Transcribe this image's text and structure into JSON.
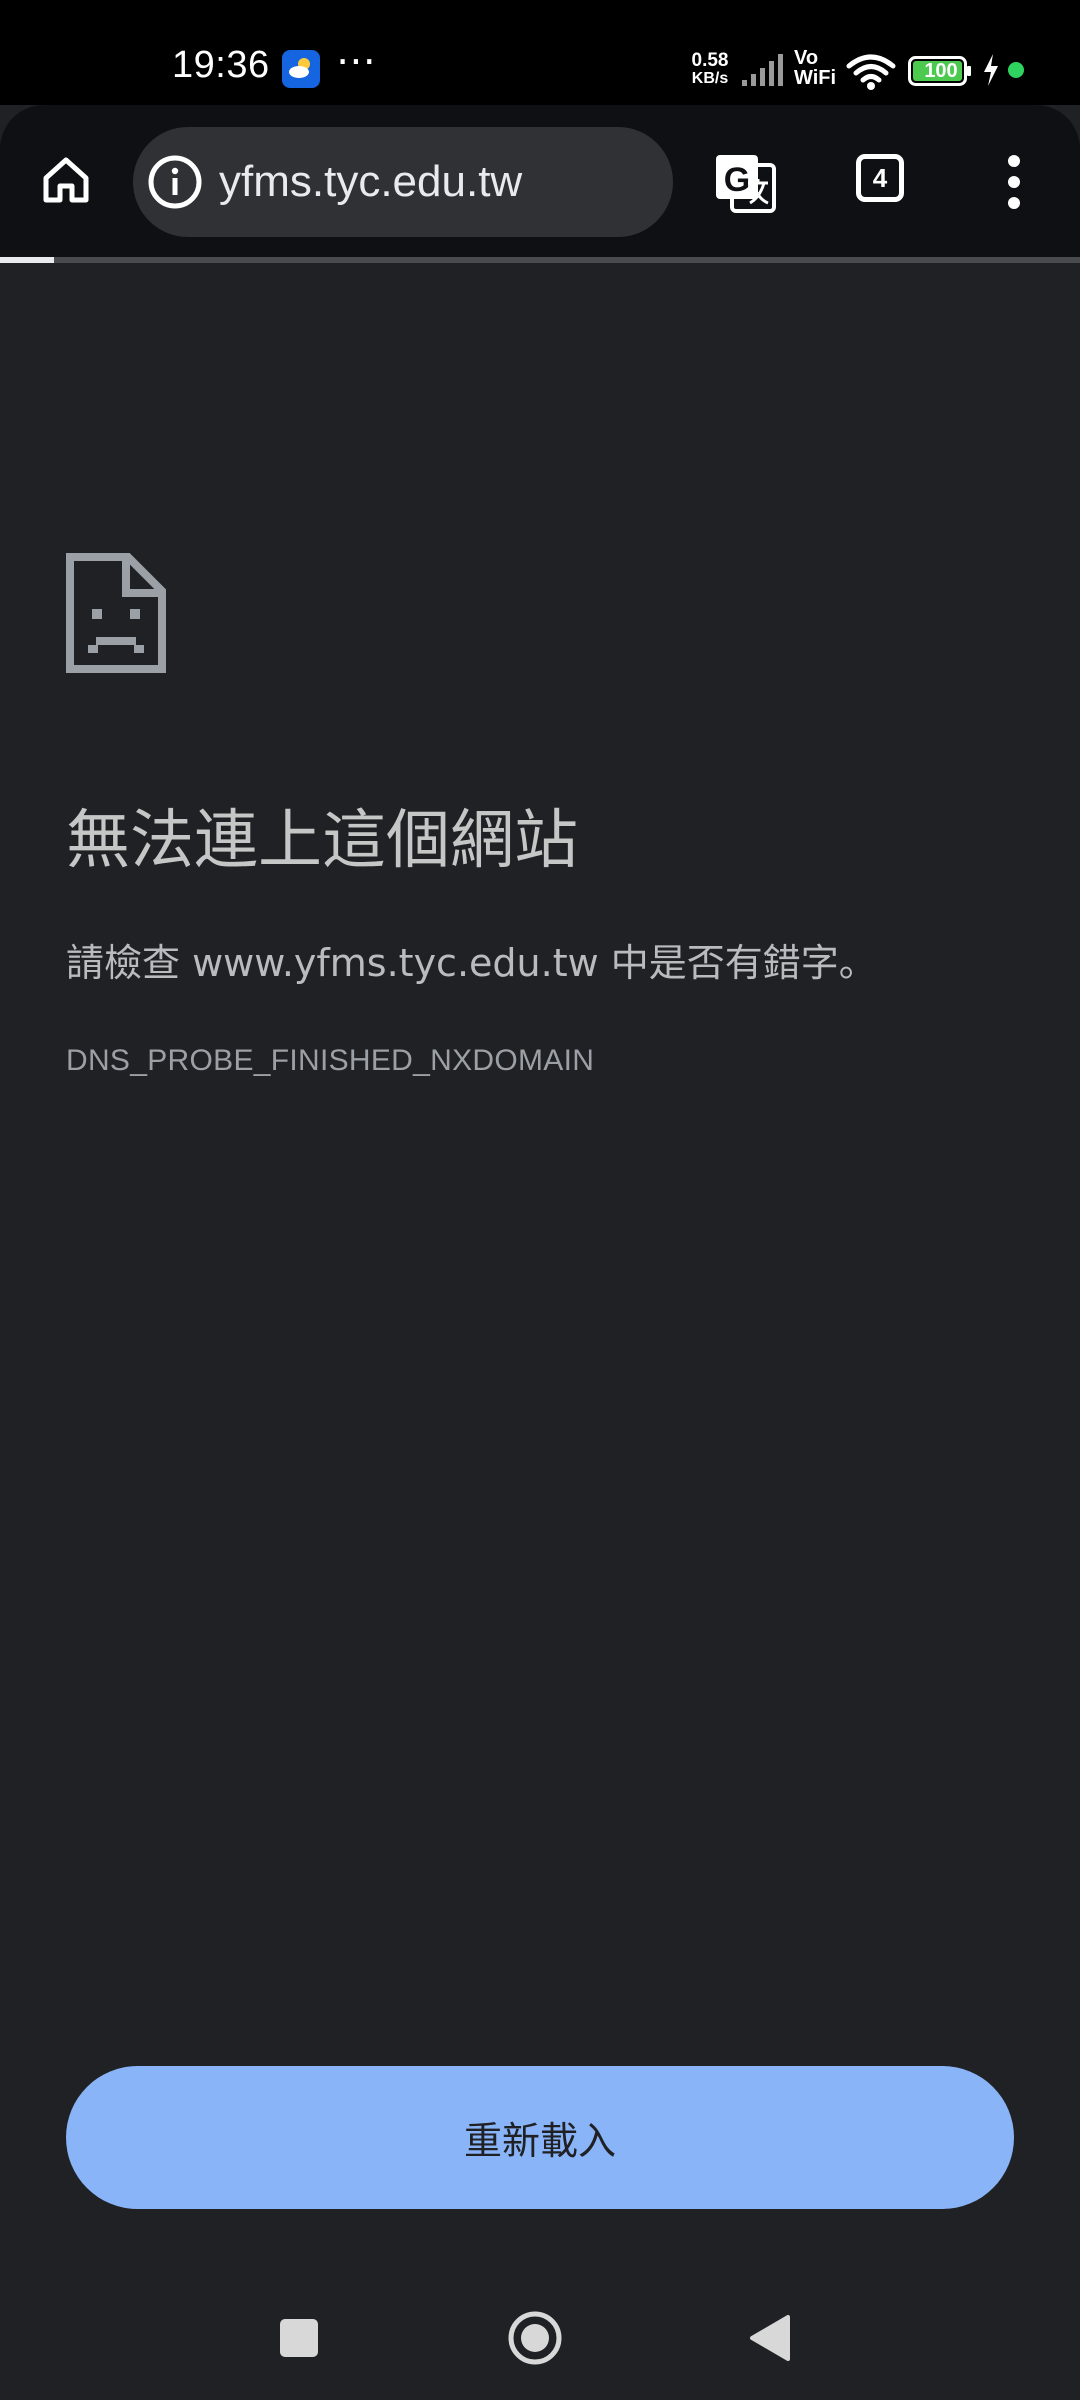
{
  "status_bar": {
    "time": "19:36",
    "more_indicator": "⋯",
    "net_speed_value": "0.58",
    "net_speed_unit": "KB/s",
    "vowifi_line1": "Vo",
    "vowifi_line2": "WiFi",
    "battery_level": "100",
    "icons": [
      "weather-app-icon",
      "signal-icon",
      "wifi-icon",
      "battery-icon",
      "charging-icon"
    ]
  },
  "toolbar": {
    "url": "yfms.tyc.edu.tw",
    "tab_count": "4",
    "load_progress": 0.05,
    "icons": [
      "home-icon",
      "info-icon",
      "translate-icon",
      "more-vert-icon"
    ]
  },
  "error": {
    "title": "無法連上這個網站",
    "description": "請檢查 www.yfms.tyc.edu.tw 中是否有錯字。",
    "code": "DNS_PROBE_FINISHED_NXDOMAIN",
    "reload_label": "重新載入"
  },
  "nav_bar": {
    "icons": [
      "recents-square-icon",
      "home-circle-icon",
      "back-triangle-icon"
    ]
  },
  "colors": {
    "background": "#202124",
    "toolbar": "#0f1013",
    "omnibox": "#303134",
    "button_accent": "#8ab4f8"
  }
}
